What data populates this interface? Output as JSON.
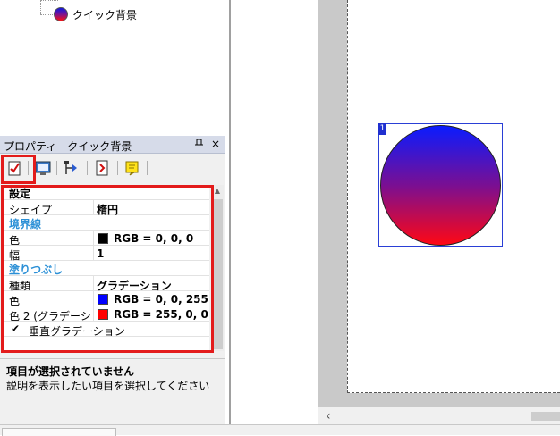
{
  "tree": {
    "item_label": "クイック背景"
  },
  "panel": {
    "title": "プロパティ - クイック背景",
    "pin_glyph": "Ὄc",
    "close_glyph": "×",
    "toolbar_icons": [
      "properties-icon",
      "monitor-icon",
      "move-icon",
      "document-icon",
      "note-icon"
    ],
    "sections": {
      "settings": "設定",
      "border": "境界線",
      "fill": "塗りつぶし"
    },
    "rows": {
      "shape": {
        "name": "シェイプ",
        "value": "楕円"
      },
      "border_color": {
        "name": "色",
        "value": "RGB = 0, 0, 0",
        "swatch": "#000000"
      },
      "border_width": {
        "name": "幅",
        "value": "1"
      },
      "fill_type": {
        "name": "種類",
        "value": "グラデーション"
      },
      "fill_color": {
        "name": "色",
        "value": "RGB = 0, 0, 255",
        "swatch": "#0000ff"
      },
      "fill_color2": {
        "name": "色 2 (グラデーション)",
        "value": "RGB = 255, 0, 0",
        "swatch": "#ff0000"
      },
      "vertical_gradient": {
        "name": "垂直グラデーション",
        "checked": true
      }
    },
    "description": {
      "title": "項目が選択されていません",
      "text": "説明を表示したい項目を選択してください"
    }
  },
  "canvas": {
    "shape_number": "1",
    "gradient_top": "#0a1cff",
    "gradient_bottom": "#ff0814"
  },
  "bottom": {
    "tab_label": ""
  },
  "colors": {
    "highlight_red": "#e31b1b",
    "category_blue": "#2a8fd6"
  }
}
